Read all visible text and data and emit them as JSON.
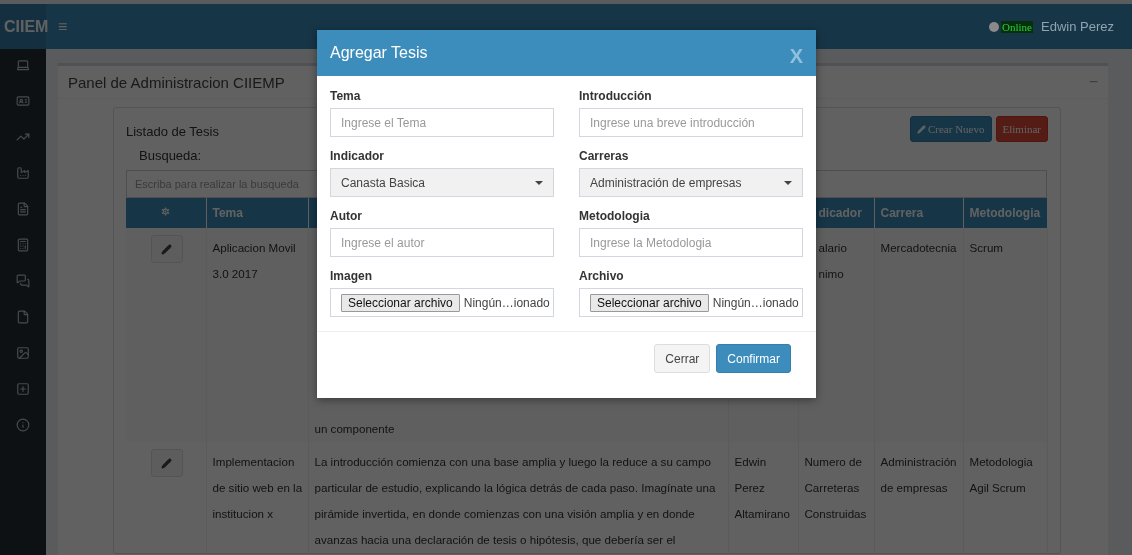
{
  "topbar": {
    "logo": "CIIEM",
    "menu_icon": "≡",
    "status": "Online",
    "user": "Edwin Perez"
  },
  "panel": {
    "title": "Panel de Administracion CIIEMP",
    "collapse": "−"
  },
  "list": {
    "title": "Listado de Tesis",
    "buttons": [
      {
        "label": "Crear Nuevo",
        "kind": "primary"
      },
      {
        "label": "Eliminar",
        "kind": "danger"
      }
    ],
    "search_label": "Busqueda:",
    "search_placeholder": "Escriba para realizar la busqueda"
  },
  "table": {
    "columns": [
      "",
      "Tema",
      "",
      "",
      "dicador",
      "Carrera",
      "Metodologia"
    ],
    "rows": [
      {
        "cells": [
          "",
          "Aplicacion Movil 3.0 2017",
          "un componente",
          "",
          "alario nimo",
          "Mercadotecnia",
          "Scrum"
        ]
      },
      {
        "cells": [
          "",
          "Implementacion de sitio web en la institucion x",
          "La introducción comienza con una base amplia y luego la reduce a su campo particular de estudio, explicando la lógica detrás de cada paso. Imagínate una pirámide invertida, en donde comienzas con una visión amplia y en donde avanzas hacia una declaración de tesis o hipótesis, que debería ser el",
          "Edwin Perez Altamirano",
          "Numero de Carreteras Construidas",
          "Administración de empresas",
          "Metodologia Agil Scrum"
        ]
      }
    ]
  },
  "modal": {
    "title": "Agregar Tesis",
    "close": "X",
    "fields": [
      {
        "label": "Tema",
        "kind": "text",
        "placeholder": "Ingrese el Tema"
      },
      {
        "label": "Introducción",
        "kind": "text",
        "placeholder": "Ingrese una breve introducción"
      },
      {
        "label": "Indicador",
        "kind": "select",
        "value": "Canasta Basica"
      },
      {
        "label": "Carreras",
        "kind": "select",
        "value": "Administración de empresas"
      },
      {
        "label": "Autor",
        "kind": "text",
        "placeholder": "Ingrese el autor"
      },
      {
        "label": "Metodologia",
        "kind": "text",
        "placeholder": "Ingrese la Metodologia"
      },
      {
        "label": "Imagen",
        "kind": "file",
        "button": "Seleccionar archivo",
        "value": "Ningún…ionado"
      },
      {
        "label": "Archivo",
        "kind": "file",
        "button": "Seleccionar archivo",
        "value": "Ningún…ionado"
      }
    ],
    "buttons": [
      {
        "label": "Cerrar",
        "kind": "default"
      },
      {
        "label": "Confirmar",
        "kind": "primary"
      }
    ]
  }
}
